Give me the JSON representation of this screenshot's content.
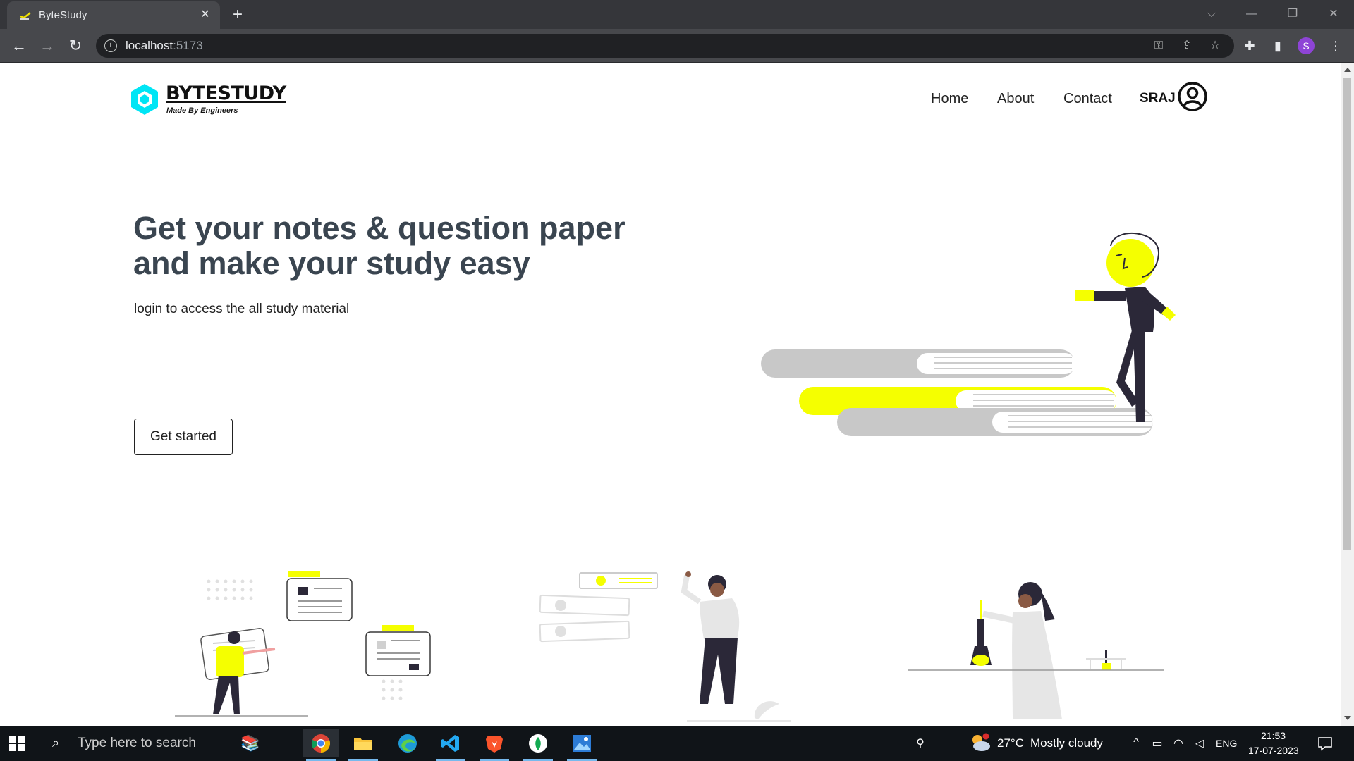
{
  "browser": {
    "tab_title": "ByteStudy",
    "tab_close_icon": "close-icon",
    "new_tab_label": "+",
    "url_host": "localhost",
    "url_port": ":5173",
    "profile_initial": "S"
  },
  "site": {
    "logo_title": "BYTESTUDY",
    "logo_subtitle": "Made By Engineers",
    "nav": [
      "Home",
      "About",
      "Contact"
    ],
    "user_name": "SRAJ"
  },
  "hero": {
    "title": "Get your notes & question paper and make your study easy",
    "subtitle": "login to access the all study material",
    "cta_label": "Get started"
  },
  "colors": {
    "accent_yellow": "#f5ff00",
    "logo_cyan": "#00e5f5",
    "heading": "#3a4550",
    "dark_figure": "#2b2838"
  },
  "taskbar": {
    "search_placeholder": "Type here to search",
    "weather_temp": "27°C",
    "weather_desc": "Mostly cloudy",
    "language": "ENG",
    "time": "21:53",
    "date": "17-07-2023"
  }
}
